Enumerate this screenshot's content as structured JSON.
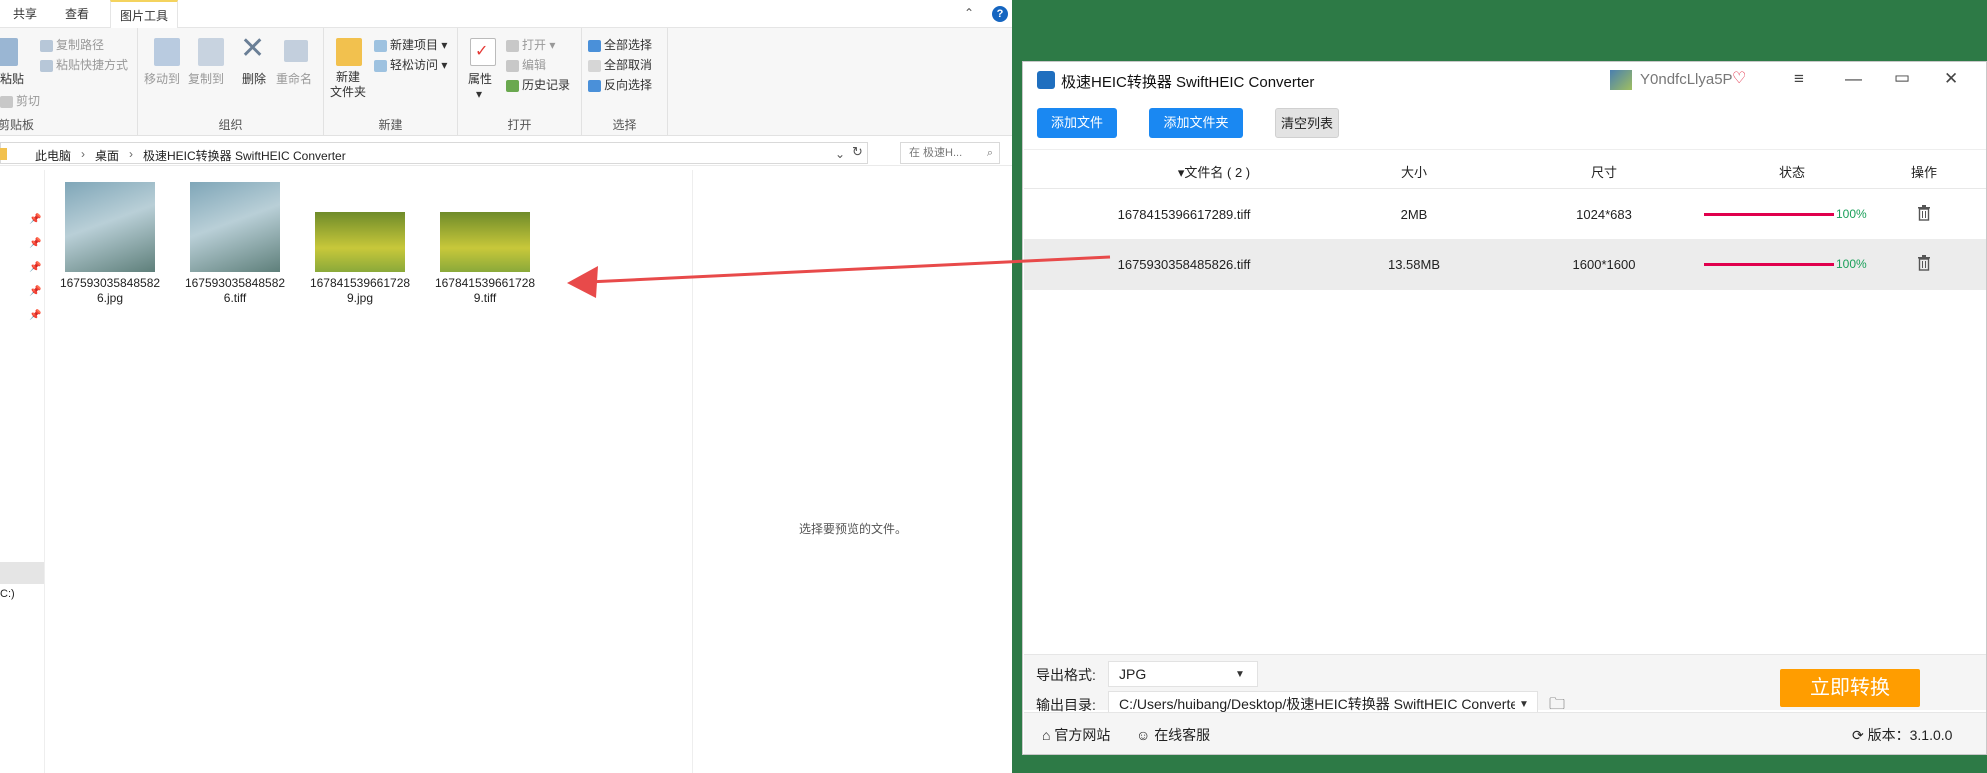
{
  "explorer": {
    "tabs": [
      "共享",
      "查看",
      "图片工具"
    ],
    "ribbon": {
      "clipboard": {
        "copy_path": "复制路径",
        "paste_shortcut": "粘贴快捷方式",
        "paste": "粘贴",
        "cut": "剪切",
        "label": "剪贴板"
      },
      "organize": {
        "move_to": "移动到",
        "copy_to": "复制到",
        "delete": "删除",
        "rename": "重命名",
        "label": "组织"
      },
      "new": {
        "new_folder": "新建\n文件夹",
        "new_item": "新建项目",
        "easy_access": "轻松访问",
        "label": "新建"
      },
      "open": {
        "properties": "属性",
        "open": "打开",
        "edit": "编辑",
        "history": "历史记录",
        "label": "打开"
      },
      "select": {
        "select_all": "全部选择",
        "select_none": "全部取消",
        "invert": "反向选择",
        "label": "选择"
      }
    },
    "breadcrumb": [
      "此电脑",
      "桌面",
      "极速HEIC转换器 SwiftHEIC Converter"
    ],
    "search_placeholder": "在 极速H...",
    "files": [
      {
        "name": "1675930358485826.jpg",
        "thumb": "flowers"
      },
      {
        "name": "1675930358485826.tiff",
        "thumb": "flowers"
      },
      {
        "name": "1678415396617289.jpg",
        "thumb": "girl"
      },
      {
        "name": "1678415396617289.tiff",
        "thumb": "girl"
      }
    ],
    "nav_drive_label": "C:)",
    "preview_text": "选择要预览的文件。"
  },
  "app": {
    "title": "极速HEIC转换器 SwiftHEIC Converter",
    "username": "Y0ndfcLlya5P",
    "buttons": {
      "add_file": "添加文件",
      "add_folder": "添加文件夹",
      "clear_list": "清空列表"
    },
    "columns": {
      "filename": "文件名 ( 2 )",
      "size": "大小",
      "dimensions": "尺寸",
      "status": "状态",
      "action": "操作"
    },
    "rows": [
      {
        "filename": "1678415396617289.tiff",
        "size": "2MB",
        "dimensions": "1024*683",
        "progress": "100%"
      },
      {
        "filename": "1675930358485826.tiff",
        "size": "13.58MB",
        "dimensions": "1600*1600",
        "progress": "100%"
      }
    ],
    "export_format_label": "导出格式:",
    "export_format_value": "JPG",
    "output_dir_label": "输出目录:",
    "output_dir_value": "C:/Users/huibang/Desktop/极速HEIC转换器 SwiftHEIC Converter",
    "convert_button": "立即转换",
    "official_site": "官方网站",
    "online_support": "在线客服",
    "version_label": "版本：",
    "version": "3.1.0.0"
  },
  "colors": {
    "accent_blue": "#1a88f2",
    "convert_orange": "#ff9d00",
    "progress_red": "#e0004d",
    "progress_text": "#1aa05a",
    "arrow_red": "#e84a4a",
    "desktop_green": "#2d7a46"
  }
}
